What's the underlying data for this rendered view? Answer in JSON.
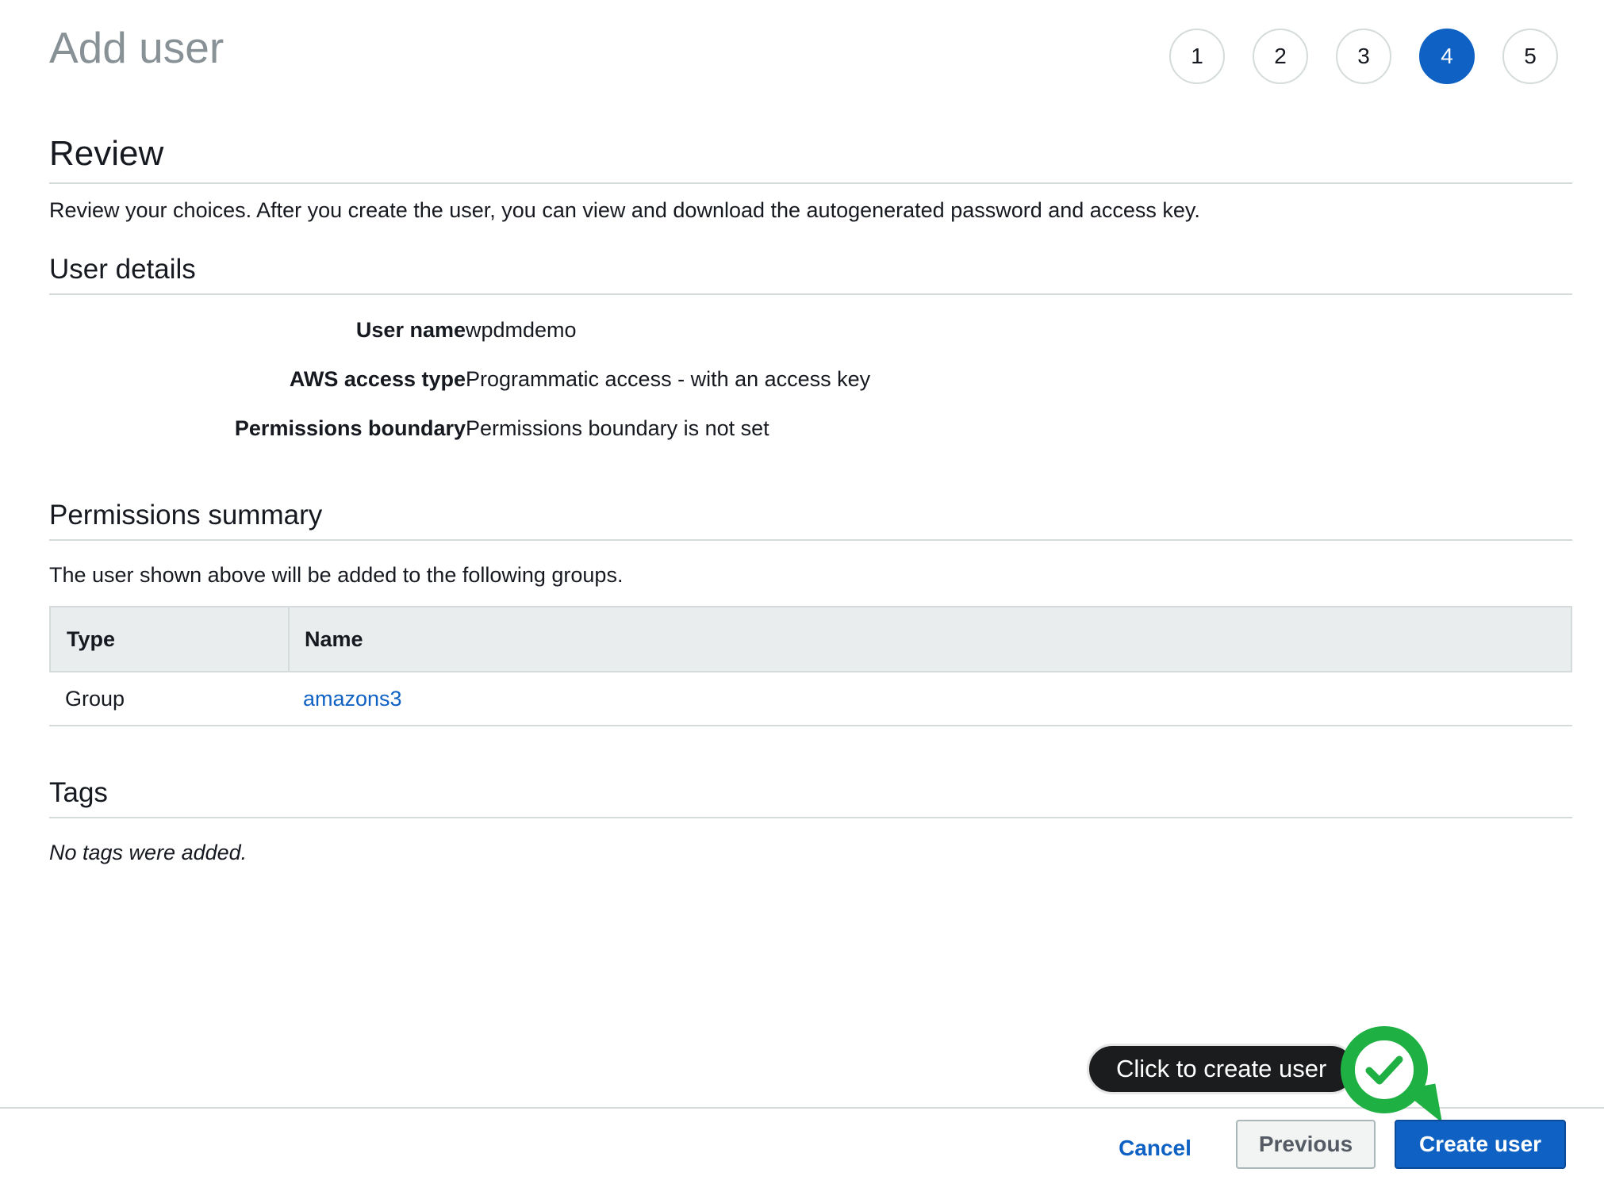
{
  "header": {
    "title": "Add user",
    "steps": [
      {
        "label": "1",
        "active": false
      },
      {
        "label": "2",
        "active": false
      },
      {
        "label": "3",
        "active": false
      },
      {
        "label": "4",
        "active": true
      },
      {
        "label": "5",
        "active": false
      }
    ]
  },
  "review": {
    "title": "Review",
    "description": "Review your choices. After you create the user, you can view and download the autogenerated password and access key."
  },
  "user_details": {
    "title": "User details",
    "rows": [
      {
        "label": "User name",
        "value": "wpdmdemo"
      },
      {
        "label": "AWS access type",
        "value": "Programmatic access - with an access key"
      },
      {
        "label": "Permissions boundary",
        "value": "Permissions boundary is not set"
      }
    ]
  },
  "permissions_summary": {
    "title": "Permissions summary",
    "description": "The user shown above will be added to the following groups.",
    "columns": [
      "Type",
      "Name"
    ],
    "rows": [
      {
        "type": "Group",
        "name": "amazons3"
      }
    ]
  },
  "tags": {
    "title": "Tags",
    "empty_text": "No tags were added."
  },
  "footer": {
    "cancel_label": "Cancel",
    "previous_label": "Previous",
    "create_label": "Create user"
  },
  "callout": {
    "text": "Click to create user",
    "icon": "checkmark-icon"
  },
  "colors": {
    "primary": "#0f62c3",
    "badge_green": "#1fb043",
    "muted_title": "#879196"
  }
}
